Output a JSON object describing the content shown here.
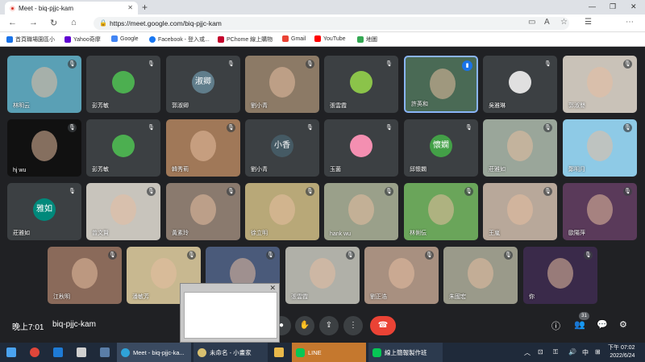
{
  "browser": {
    "tab_title": "Meet - biq-pjjc-kam",
    "url": "https://meet.google.com/biq-pjjc-kam"
  },
  "bookmarks": [
    {
      "label": "首頁職場園區小",
      "color": "#1a73e8"
    },
    {
      "label": "Yahoo奇摩",
      "color": "#6001d2"
    },
    {
      "label": "Google",
      "color": "#4285f4"
    },
    {
      "label": "Facebook - 登入或...",
      "color": "#1877f2"
    },
    {
      "label": "PChome 線上購物",
      "color": "#c4002b"
    },
    {
      "label": "Gmail",
      "color": "#ea4335"
    },
    {
      "label": "YouTube",
      "color": "#ff0000"
    },
    {
      "label": "地圖",
      "color": "#34a853"
    }
  ],
  "participants": [
    {
      "name": "林明云",
      "bg": "#5aa0b5"
    },
    {
      "name": "彭芳敏",
      "bg": "#3c4043",
      "avatar": "",
      "avbg": "#4caf50"
    },
    {
      "name": "郭淑卿",
      "bg": "#3c4043",
      "avatar": "淑卿",
      "avbg": "#607d8b"
    },
    {
      "name": "劉小青",
      "bg": "#8c7a66"
    },
    {
      "name": "張雲霞",
      "bg": "#3c4043",
      "avatar": "",
      "avbg": "#8bc34a"
    },
    {
      "name": "許英和",
      "bg": "#4a6a55",
      "speaking": true
    },
    {
      "name": "吳雅琳",
      "bg": "#3c4043",
      "avatar": "",
      "avbg": "#e0e0e0"
    },
    {
      "name": "郭淑嬰",
      "bg": "#c9c2b8"
    },
    {
      "name": "hj wu",
      "bg": "#111111"
    },
    {
      "name": "彭芳敏",
      "bg": "#3c4043",
      "avatar": "",
      "avbg": "#4caf50"
    },
    {
      "name": "韓秀莉",
      "bg": "#a07858"
    },
    {
      "name": "劉小青",
      "bg": "#3c4043",
      "avatar": "小香",
      "avbg": "#455a64"
    },
    {
      "name": "玉菌",
      "bg": "#3c4043",
      "avatar": "",
      "avbg": "#f48fb1"
    },
    {
      "name": "邱懷嫻",
      "bg": "#3c4043",
      "avatar": "懷嫻",
      "avbg": "#43a047"
    },
    {
      "name": "莊雅如",
      "bg": "#9aa69a"
    },
    {
      "name": "鄭明月",
      "bg": "#8ecae6"
    },
    {
      "name": "莊雅如",
      "bg": "#3c4043",
      "avatar": "雅如",
      "avbg": "#00897b"
    },
    {
      "name": "曾文賢",
      "bg": "#c8c4bc"
    },
    {
      "name": "黃素玲",
      "bg": "#8a7a6e"
    },
    {
      "name": "徐立明",
      "bg": "#b8a878"
    },
    {
      "name": "hank wu",
      "bg": "#9aa08a"
    },
    {
      "name": "林俐伝",
      "bg": "#6aa55a"
    },
    {
      "name": "王嵐",
      "bg": "#b8a89a"
    },
    {
      "name": "歐陽萍",
      "bg": "#5a3a5a"
    },
    {
      "name": "江秋明",
      "bg": "#8a6a5a"
    },
    {
      "name": "潘敏芳",
      "bg": "#c8b890"
    },
    {
      "name": "",
      "bg": "#4a5a7a"
    },
    {
      "name": "張雲霞",
      "bg": "#b0b0a8"
    },
    {
      "name": "劉正浩",
      "bg": "#a89080"
    },
    {
      "name": "朱國宏",
      "bg": "#9a9a8a"
    },
    {
      "name": "你",
      "bg": "#3a2a4a"
    }
  ],
  "controls": {
    "time": "晚上7:01",
    "meeting_code": "biq-pjjc-kam",
    "participant_count": "31"
  },
  "taskbar": {
    "meet_label": "Meet - biq-pjjc-ka...",
    "paint_label": "未命名 - 小畫家",
    "line_label": "LINE",
    "report_label": "線上簡報製作班",
    "clock_time": "下午 07:02",
    "clock_date": "2022/6/24",
    "ime": "中"
  }
}
